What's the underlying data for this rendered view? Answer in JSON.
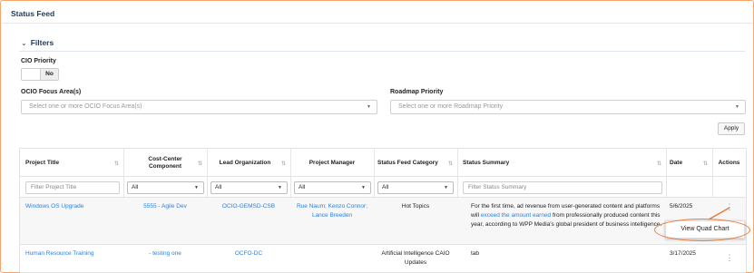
{
  "header": {
    "title": "Status Feed"
  },
  "filters": {
    "toggle_label": "Filters",
    "cio_priority": {
      "label": "CIO Priority",
      "value": "No"
    },
    "ocio_focus": {
      "label": "OCIO Focus Area(s)",
      "placeholder": "Select one or more OCIO Focus Area(s)"
    },
    "roadmap": {
      "label": "Roadmap Priority",
      "placeholder": "Select one or more Roadmap Priority"
    },
    "apply_label": "Apply"
  },
  "table": {
    "columns": {
      "project_title": "Project Title",
      "cost_center": "Cost-Center Component",
      "lead_org": "Lead Organization",
      "project_manager": "Project Manager",
      "status_category": "Status Feed Category",
      "status_summary": "Status Summary",
      "date": "Date",
      "actions": "Actions"
    },
    "filter_row": {
      "project_title_placeholder": "Filter Project Title",
      "cost_center": "All",
      "lead_org": "All",
      "project_manager": "All",
      "status_category": "All",
      "status_summary_placeholder": "Filter Status Summary"
    },
    "rows": [
      {
        "project_title": "Windows OS Upgrade",
        "cost_center": "5555 - Agile Dev",
        "lead_org": "OCIO-GEMSD-CSB",
        "project_manager": "Rue Naum; Kenzo Connor; Lance Breeden",
        "status_category": "Hot Topics",
        "summary_pre": "For the first time, ad revenue from user-generated content and platforms will ",
        "summary_link": "exceed the amount earned",
        "summary_post": " from professionally produced content this year, according to WPP Media's global president of business intelligence.",
        "date": "5/6/2025"
      },
      {
        "project_title": "Human Resource Training",
        "cost_center": "- testing one",
        "lead_org": "OCFO-DC",
        "project_manager": "",
        "status_category": "Artificial Intelligence CAIO Updates",
        "summary_pre": "tab",
        "summary_link": "",
        "summary_post": "",
        "date": "3/17/2025"
      }
    ]
  },
  "action_menu": {
    "item": "View Quad Chart"
  },
  "colors": {
    "accent_orange": "#e87a3a",
    "link_blue": "#2f7ed8",
    "title_navy": "#1f3b5c"
  }
}
